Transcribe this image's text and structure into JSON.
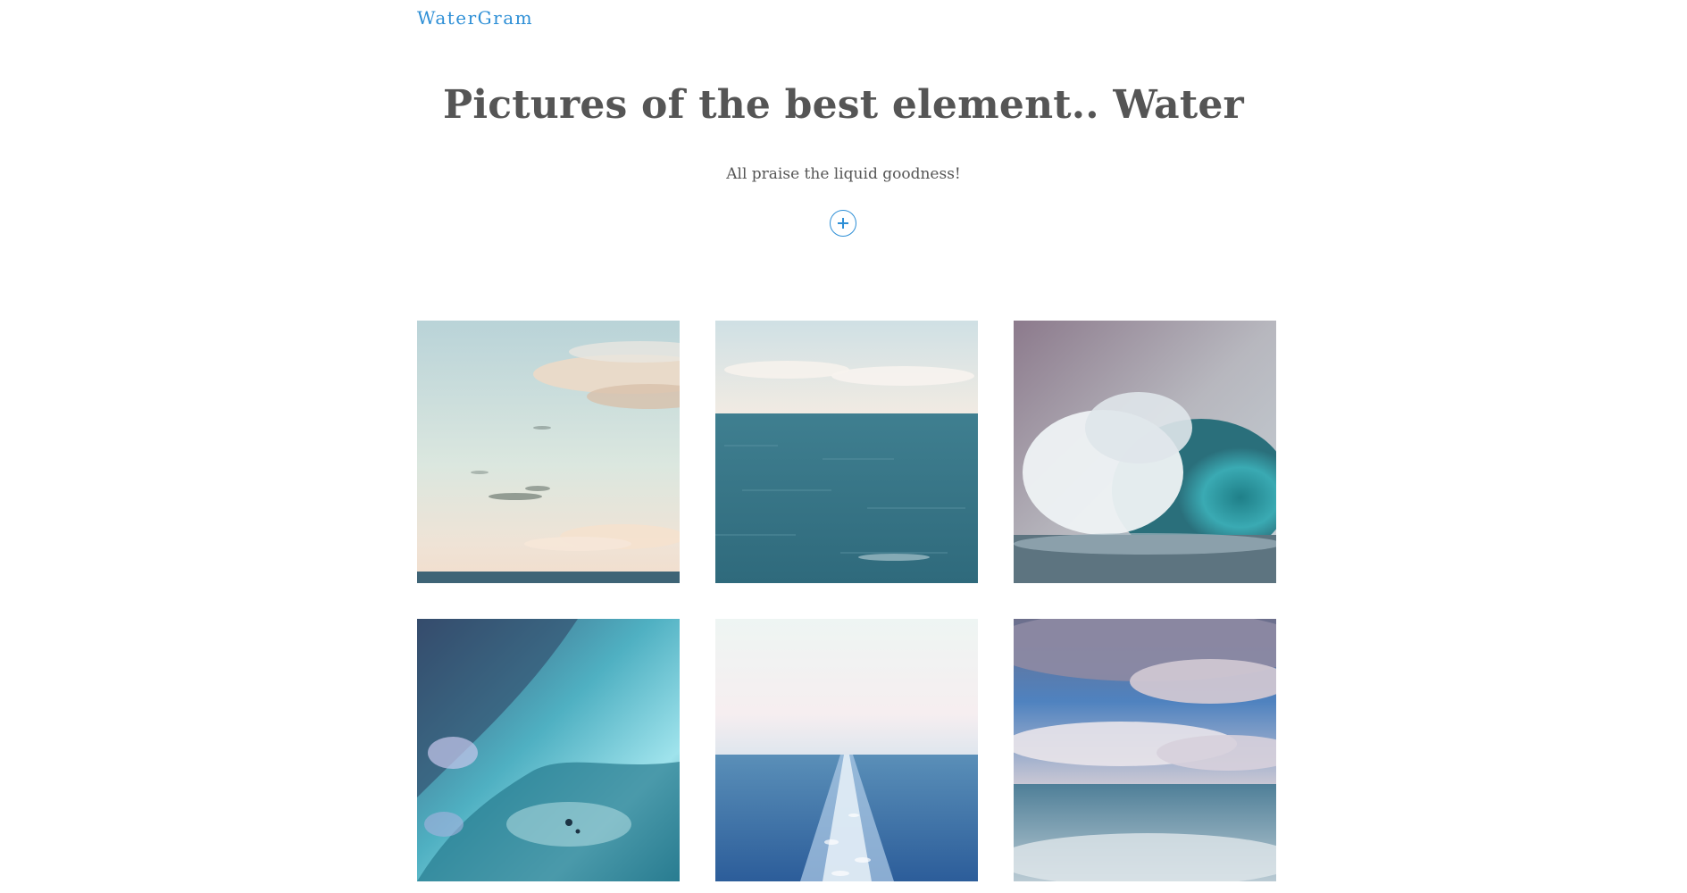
{
  "nav": {
    "brand": "WaterGram"
  },
  "hero": {
    "title": "Pictures of the best element.. Water",
    "subtitle": "All praise the liquid goodness!",
    "add_icon": "plus-circle-icon"
  },
  "gallery": {
    "photos": [
      {
        "subject": "sky-over-horizon-photo"
      },
      {
        "subject": "open-sea-photo"
      },
      {
        "subject": "curling-wave-photo"
      },
      {
        "subject": "underwater-wave-photo"
      },
      {
        "subject": "boat-wake-photo"
      },
      {
        "subject": "cloudy-sea-photo"
      }
    ]
  },
  "colors": {
    "accent": "#2e8fd6",
    "heading": "#555555"
  }
}
